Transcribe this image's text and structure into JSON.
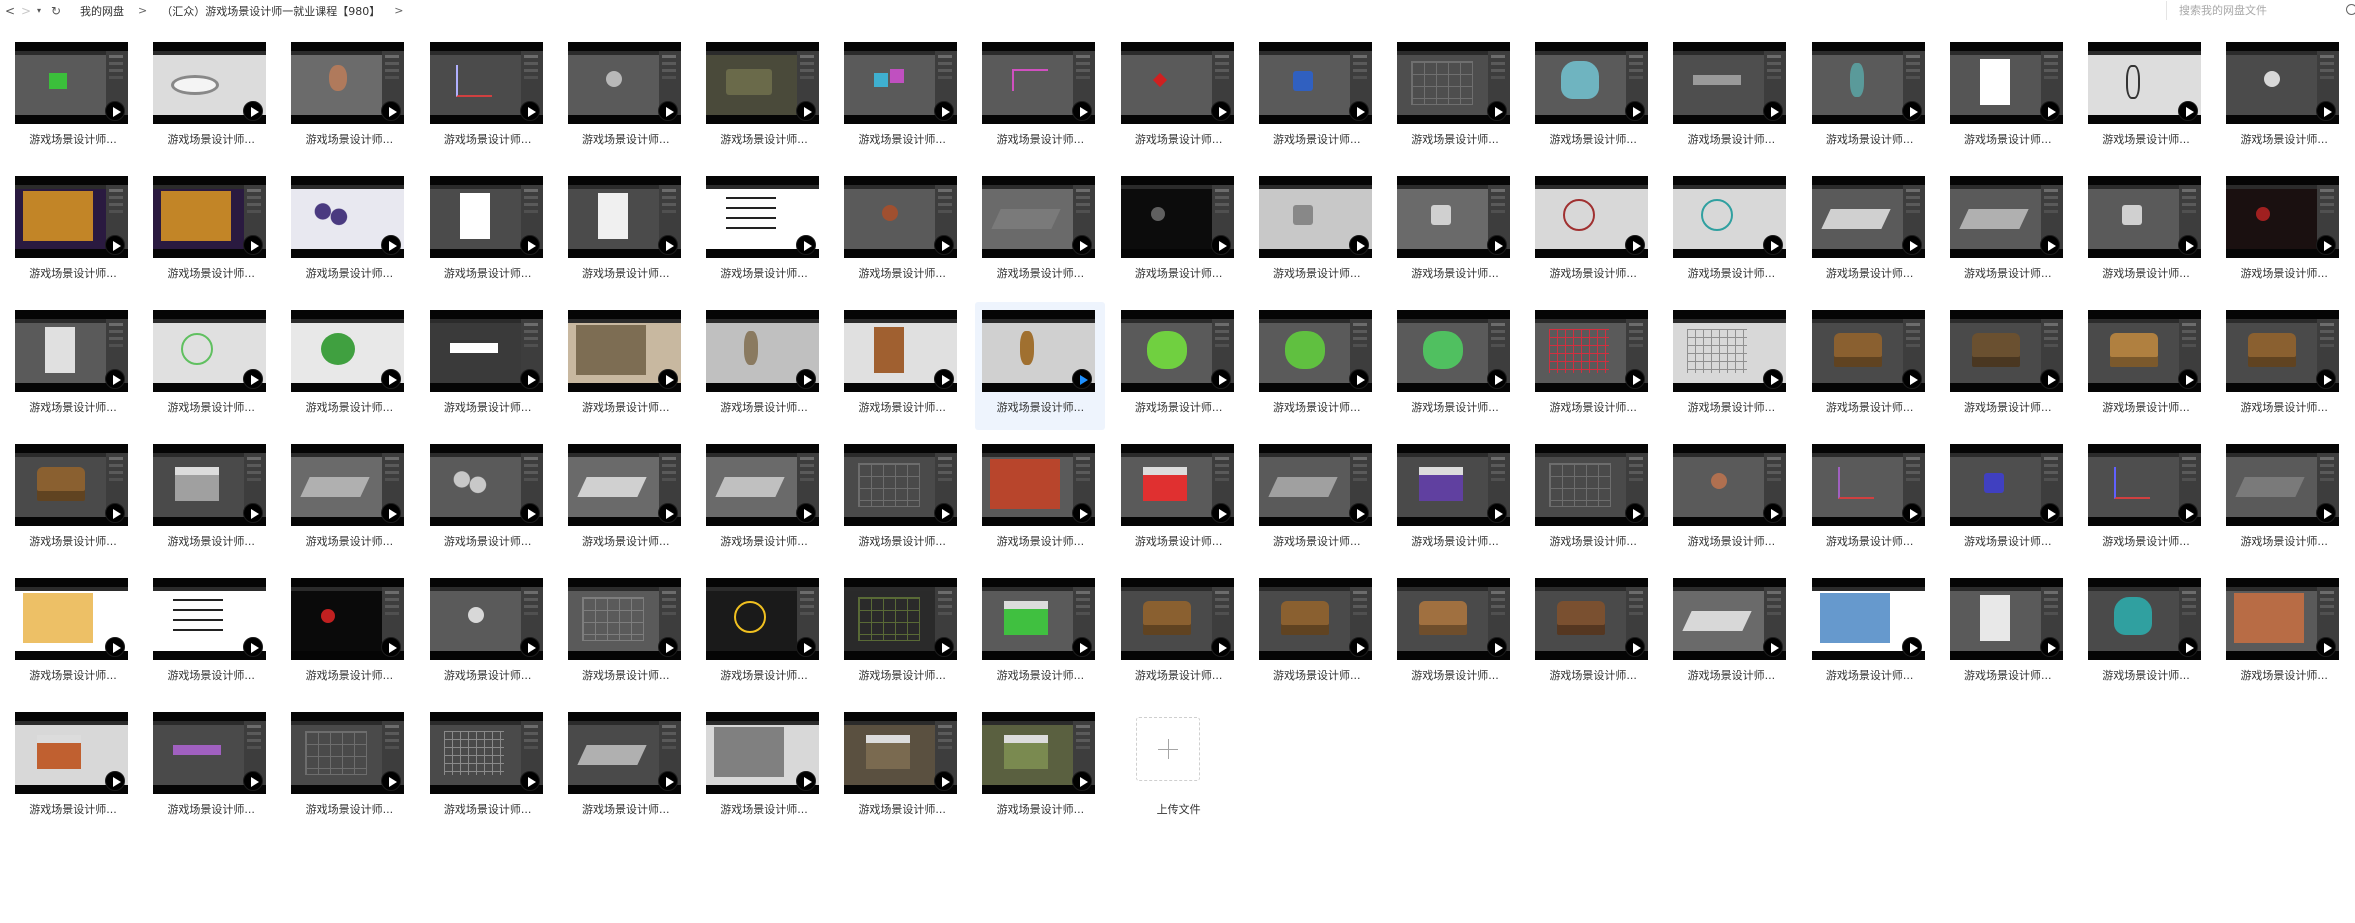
{
  "nav": {
    "back_label": "<",
    "forward_label": ">",
    "history_label": "▾",
    "refresh_label": "↻"
  },
  "breadcrumb": {
    "items": [
      "我的网盘",
      "（汇众）游戏场景设计师一就业课程【980】"
    ],
    "separator": ">"
  },
  "search": {
    "placeholder": "搜索我的网盘文件"
  },
  "file_label": "游戏场景设计师...",
  "upload": {
    "label": "上传文件"
  },
  "files": [
    {
      "scene": "#5a5a5a",
      "accent": "#3bbf3b",
      "shape": "box"
    },
    {
      "scene": "#dcdcdc",
      "accent": "#888888",
      "shape": "plate"
    },
    {
      "scene": "#6b6b6b",
      "accent": "#b07a5c",
      "shape": "head"
    },
    {
      "scene": "#4b4b4b",
      "accent": "#b0b0ff",
      "shape": "axes"
    },
    {
      "scene": "#5a5a5a",
      "accent": "#b8b8b8",
      "shape": "ball"
    },
    {
      "scene": "#4a4a3a",
      "accent": "#6a6a4a",
      "shape": "truck"
    },
    {
      "scene": "#5a5a5a",
      "accent": "#3fb0d0",
      "shape": "cubes"
    },
    {
      "scene": "#5a5a5a",
      "accent": "#d050c0",
      "shape": "line"
    },
    {
      "scene": "#5a5a5a",
      "accent": "#d02020",
      "shape": "star"
    },
    {
      "scene": "#5a5a5a",
      "accent": "#3060c0",
      "shape": "cube"
    },
    {
      "scene": "#4e4e4e",
      "accent": "#8a8a8a",
      "shape": "wire"
    },
    {
      "scene": "#5a5a5a",
      "accent": "#6fb4c0",
      "shape": "cylinder"
    },
    {
      "scene": "#4e4e4e",
      "accent": "#9a9a9a",
      "shape": "bar"
    },
    {
      "scene": "#5a5a5a",
      "accent": "#5a9a9a",
      "shape": "vase"
    },
    {
      "scene": "#555555",
      "accent": "#ffffff",
      "shape": "paper"
    },
    {
      "scene": "#dddddd",
      "accent": "#333333",
      "shape": "sketch"
    },
    {
      "scene": "#4b4b4b",
      "accent": "#d8d8d8",
      "shape": "ball"
    },
    {
      "scene": "#2a1a40",
      "accent": "#e8a020",
      "shape": "poster"
    },
    {
      "scene": "#2a1a40",
      "accent": "#e8a020",
      "shape": "poster"
    },
    {
      "scene": "#e8e8f0",
      "accent": "#4a3a80",
      "shape": "cluster"
    },
    {
      "scene": "#4b4b4b",
      "accent": "#ffffff",
      "shape": "paper"
    },
    {
      "scene": "#4b4b4b",
      "accent": "#f0f0f0",
      "shape": "paper"
    },
    {
      "scene": "#ffffff",
      "accent": "#222222",
      "shape": "strokes"
    },
    {
      "scene": "#5a5a5a",
      "accent": "#a05030",
      "shape": "ball"
    },
    {
      "scene": "#6a6a6a",
      "accent": "#7a7a7a",
      "shape": "flat"
    },
    {
      "scene": "#0c0c0c",
      "accent": "#606060",
      "shape": "dark"
    },
    {
      "scene": "#c8c8c8",
      "accent": "#888888",
      "shape": "cube"
    },
    {
      "scene": "#6a6a6a",
      "accent": "#d0d0d0",
      "shape": "cube"
    },
    {
      "scene": "#d8d8d8",
      "accent": "#a03030",
      "shape": "circle"
    },
    {
      "scene": "#d8d8d8",
      "accent": "#30a0a0",
      "shape": "circle"
    },
    {
      "scene": "#5a5a5a",
      "accent": "#d0d0d0",
      "shape": "flat"
    },
    {
      "scene": "#5a5a5a",
      "accent": "#b0b0b0",
      "shape": "flat"
    },
    {
      "scene": "#5a5a5a",
      "accent": "#d0d0d0",
      "shape": "cube"
    },
    {
      "scene": "#1a1010",
      "accent": "#a02020",
      "shape": "dark"
    },
    {
      "scene": "#5a5a5a",
      "accent": "#e0e0e0",
      "shape": "paper"
    },
    {
      "scene": "#e0e0e0",
      "accent": "#60c060",
      "shape": "circle"
    },
    {
      "scene": "#e8e8e8",
      "accent": "#40a040",
      "shape": "apple"
    },
    {
      "scene": "#3a3a3a",
      "accent": "#ffffff",
      "shape": "bar"
    },
    {
      "scene": "#c8b8a0",
      "accent": "#6a5a40",
      "shape": "poster"
    },
    {
      "scene": "#c0c0c0",
      "accent": "#8a7a60",
      "shape": "vase"
    },
    {
      "scene": "#e0e0e0",
      "accent": "#a06030",
      "shape": "paper"
    },
    {
      "scene": "#d0d0d0",
      "accent": "#a07030",
      "shape": "vase"
    },
    {
      "scene": "#5a5a5a",
      "accent": "#70d040",
      "shape": "blob"
    },
    {
      "scene": "#5a5a5a",
      "accent": "#60c040",
      "shape": "blob"
    },
    {
      "scene": "#5a5a5a",
      "accent": "#50c060",
      "shape": "blob"
    },
    {
      "scene": "#5a5a5a",
      "accent": "#d03040",
      "shape": "grid"
    },
    {
      "scene": "#d8d8d8",
      "accent": "#909090",
      "shape": "grid"
    },
    {
      "scene": "#4a4a4a",
      "accent": "#8a6030",
      "shape": "chest"
    },
    {
      "scene": "#4a4a4a",
      "accent": "#6a5030",
      "shape": "chest"
    },
    {
      "scene": "#4a4a4a",
      "accent": "#b08040",
      "shape": "chest"
    },
    {
      "scene": "#4a4a4a",
      "accent": "#8a6030",
      "shape": "chest"
    },
    {
      "scene": "#4a4a4a",
      "accent": "#8a6030",
      "shape": "chest"
    },
    {
      "scene": "#4a4a4a",
      "accent": "#a0a0a0",
      "shape": "house"
    },
    {
      "scene": "#6a6a6a",
      "accent": "#b0b0b0",
      "shape": "flat"
    },
    {
      "scene": "#5a5a5a",
      "accent": "#c8c8c8",
      "shape": "cluster"
    },
    {
      "scene": "#6a6a6a",
      "accent": "#d0d0d0",
      "shape": "flat"
    },
    {
      "scene": "#6a6a6a",
      "accent": "#c0c0c0",
      "shape": "flat"
    },
    {
      "scene": "#4a4a4a",
      "accent": "#8a8a8a",
      "shape": "wire"
    },
    {
      "scene": "#5a5a5a",
      "accent": "#d04020",
      "shape": "poster"
    },
    {
      "scene": "#5a5a5a",
      "accent": "#e03030",
      "shape": "house"
    },
    {
      "scene": "#5a5a5a",
      "accent": "#a0a0a0",
      "shape": "flat"
    },
    {
      "scene": "#4a4a4a",
      "accent": "#6040a0",
      "shape": "house"
    },
    {
      "scene": "#4a4a4a",
      "accent": "#8a8a8a",
      "shape": "wire"
    },
    {
      "scene": "#5a5a5a",
      "accent": "#b07050",
      "shape": "ball"
    },
    {
      "scene": "#5a5a5a",
      "accent": "#a060c0",
      "shape": "axes"
    },
    {
      "scene": "#4e4e4e",
      "accent": "#4040c0",
      "shape": "cube"
    },
    {
      "scene": "#4e4e4e",
      "accent": "#6060ff",
      "shape": "axes"
    },
    {
      "scene": "#5a5a5a",
      "accent": "#7a7a7a",
      "shape": "flat"
    },
    {
      "scene": "#ffffff",
      "accent": "#e8b040",
      "shape": "poster"
    },
    {
      "scene": "#ffffff",
      "accent": "#222222",
      "shape": "strokes"
    },
    {
      "scene": "#0a0a0a",
      "accent": "#c02020",
      "shape": "dark"
    },
    {
      "scene": "#5a5a5a",
      "accent": "#d8d8d8",
      "shape": "ball"
    },
    {
      "scene": "#5a5a5a",
      "accent": "#9a9a9a",
      "shape": "wire"
    },
    {
      "scene": "#1a1a1a",
      "accent": "#f0c020",
      "shape": "circle"
    },
    {
      "scene": "#2a2a2a",
      "accent": "#80a040",
      "shape": "wire"
    },
    {
      "scene": "#5a5a5a",
      "accent": "#40c040",
      "shape": "house"
    },
    {
      "scene": "#4a4a4a",
      "accent": "#8a6030",
      "shape": "chest"
    },
    {
      "scene": "#4a4a4a",
      "accent": "#8a6030",
      "shape": "chest"
    },
    {
      "scene": "#4a4a4a",
      "accent": "#a07040",
      "shape": "chest"
    },
    {
      "scene": "#4a4a4a",
      "accent": "#7a5030",
      "shape": "chest"
    },
    {
      "scene": "#6a6a6a",
      "accent": "#d8d8d8",
      "shape": "flat"
    },
    {
      "scene": "#ffffff",
      "accent": "#4080c0",
      "shape": "poster"
    },
    {
      "scene": "#5a5a5a",
      "accent": "#e8e8e8",
      "shape": "paper"
    },
    {
      "scene": "#4a4a4a",
      "accent": "#30a0a0",
      "shape": "cylinder"
    },
    {
      "scene": "#5a5a5a",
      "accent": "#d07040",
      "shape": "poster"
    },
    {
      "scene": "#d8d8d8",
      "accent": "#c06030",
      "shape": "house"
    },
    {
      "scene": "#4a4a4a",
      "accent": "#a060c0",
      "shape": "bar"
    },
    {
      "scene": "#4a4a4a",
      "accent": "#8a8a8a",
      "shape": "wire"
    },
    {
      "scene": "#4a4a4a",
      "accent": "#8a8a8a",
      "shape": "grid"
    },
    {
      "scene": "#4a4a4a",
      "accent": "#b0b0b0",
      "shape": "flat"
    },
    {
      "scene": "#d8d8d8",
      "accent": "#6a6a6a",
      "shape": "poster"
    },
    {
      "scene": "#5a5040",
      "accent": "#7a6a50",
      "shape": "house"
    },
    {
      "scene": "#5a6040",
      "accent": "#7a8a50",
      "shape": "house"
    }
  ],
  "selected_index": 41
}
